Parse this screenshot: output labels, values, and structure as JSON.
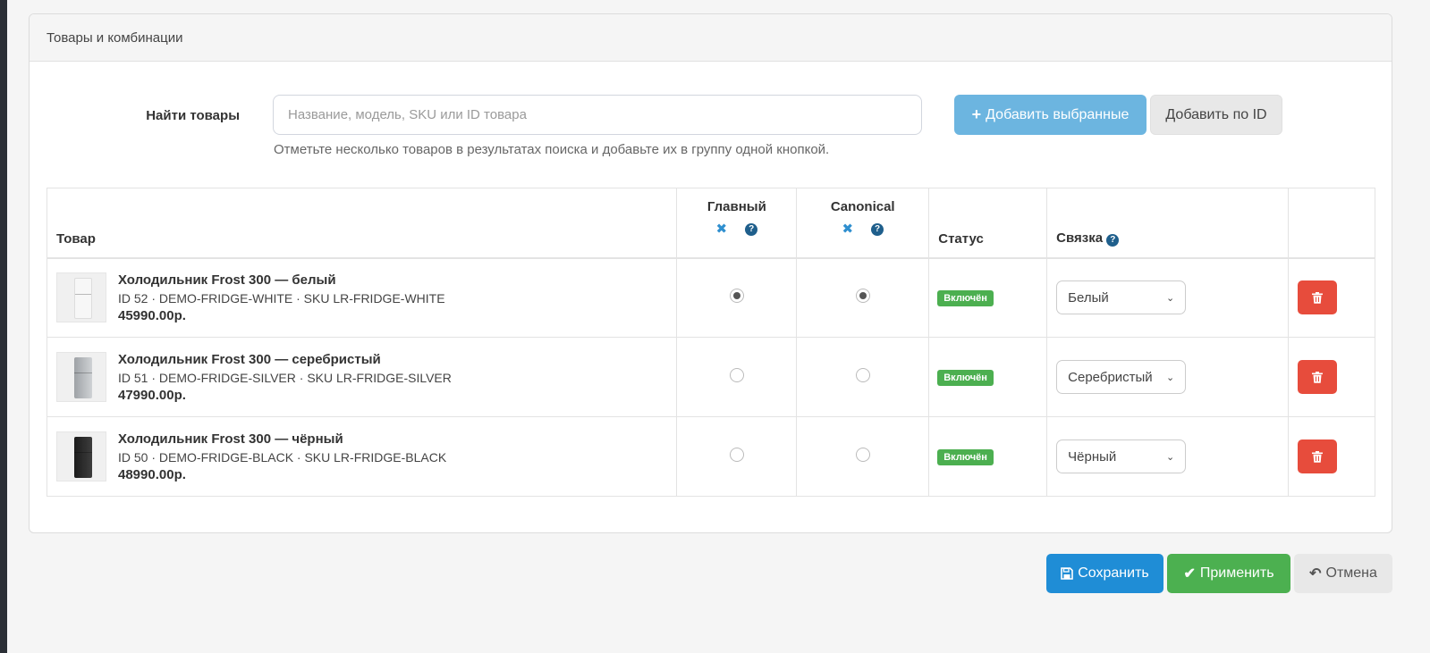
{
  "panel": {
    "title": "Товары и комбинации"
  },
  "search": {
    "label": "Найти товары",
    "placeholder": "Название, модель, SKU или ID товара",
    "help": "Отметьте несколько товаров в результатах поиска и добавьте их в группу одной кнопкой.",
    "add_selected_label": "Добавить выбранные",
    "add_by_id_label": "Добавить по ID"
  },
  "table": {
    "headers": {
      "product": "Товар",
      "main": "Главный",
      "canonical": "Canonical",
      "status": "Статус",
      "link": "Связка"
    },
    "rows": [
      {
        "name": "Холодильник Frost 300 — белый",
        "meta": "ID 52 · DEMO-FRIDGE-WHITE · SKU LR-FRIDGE-WHITE",
        "price": "45990.00р.",
        "main_checked": true,
        "canonical_checked": true,
        "status": "Включён",
        "link_value": "Белый",
        "thumb_color": "#f4f4f4"
      },
      {
        "name": "Холодильник Frost 300 — серебристый",
        "meta": "ID 51 · DEMO-FRIDGE-SILVER · SKU LR-FRIDGE-SILVER",
        "price": "47990.00р.",
        "main_checked": false,
        "canonical_checked": false,
        "status": "Включён",
        "link_value": "Серебристый",
        "thumb_color": "#b9bcbf"
      },
      {
        "name": "Холодильник Frost 300 — чёрный",
        "meta": "ID 50 · DEMO-FRIDGE-BLACK · SKU LR-FRIDGE-BLACK",
        "price": "48990.00р.",
        "main_checked": false,
        "canonical_checked": false,
        "status": "Включён",
        "link_value": "Чёрный",
        "thumb_color": "#2a2a2a"
      }
    ]
  },
  "actions": {
    "save_label": "Сохранить",
    "apply_label": "Применить",
    "cancel_label": "Отмена"
  },
  "colors": {
    "primary": "#1f8dd6",
    "success": "#4cb050",
    "danger": "#e74c3c",
    "info_light": "#6cb5e0"
  }
}
